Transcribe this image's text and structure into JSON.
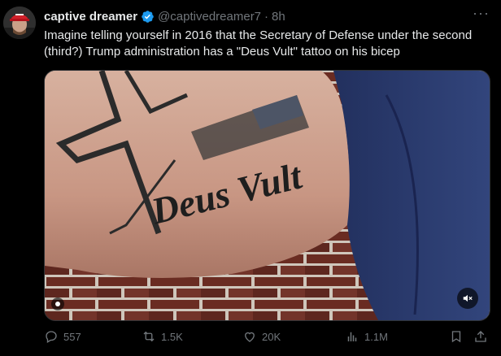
{
  "tweet": {
    "author_name": "captive dreamer",
    "handle": "@captivedreamer7",
    "separator": "·",
    "time": "8h",
    "more": "···",
    "text": "Imagine telling yourself in 2016 that the Secretary of Defense under the second (third?) Trump administration has a \"Deus Vult\" tattoo on his bicep"
  },
  "media": {
    "tattoo_text": "Deus Vult",
    "mute_icon": "speaker-muted-icon"
  },
  "actions": {
    "replies": "557",
    "reposts": "1.5K",
    "likes": "20K",
    "views": "1.1M"
  },
  "colors": {
    "background": "#000000",
    "text": "#e7e9ea",
    "muted": "#71767b",
    "verified": "#1d9bf0"
  }
}
